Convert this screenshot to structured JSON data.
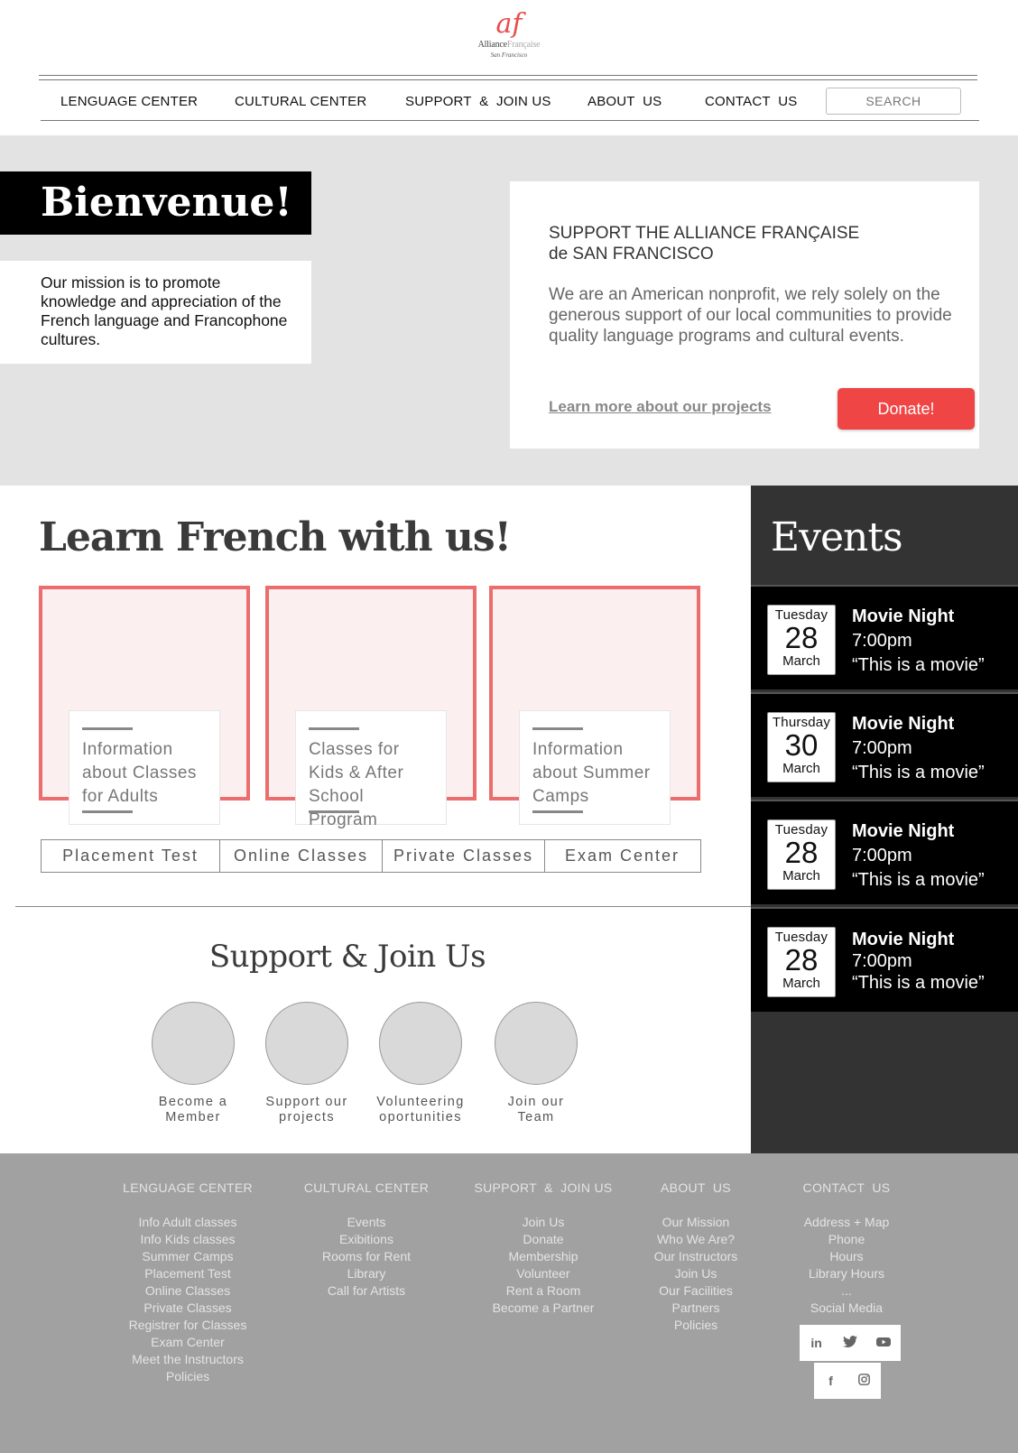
{
  "logo": {
    "mark": "af",
    "name_dark": "Alliance",
    "name_light": "Française",
    "city": "San Francisco"
  },
  "nav": {
    "items": [
      "LENGUAGE CENTER",
      "CULTURAL CENTER",
      "SUPPORT  &  JOIN US",
      "ABOUT  US",
      "CONTACT  US"
    ],
    "search_placeholder": "SEARCH"
  },
  "hero": {
    "welcome": "Bienvenue!",
    "mission": "Our mission is to promote knowledge and appreciation of the French language and Francophone cultures.",
    "support_title_1": "SUPPORT THE ALLIANCE FRANÇAISE",
    "support_title_2": "de SAN FRANCISCO",
    "support_body": "We are an American nonprofit, we rely solely on the generous support of our local communities to provide quality language programs and cultural events.",
    "learn_more": "Learn more about our projects",
    "donate": "Donate!"
  },
  "learn": {
    "title": "Learn French with us!",
    "cards": [
      "Information about Classes for Adults",
      "Classes for Kids & After School Program",
      "Information about Summer Camps"
    ],
    "tabs": [
      "Placement Test",
      "Online Classes",
      "Private Classes",
      "Exam Center"
    ]
  },
  "support_join": {
    "title": "Support & Join Us",
    "items": [
      {
        "line1": "Become a",
        "line2": "Member"
      },
      {
        "line1": "Support our",
        "line2": "projects"
      },
      {
        "line1": "Volunteering",
        "line2": "oportunities"
      },
      {
        "line1": "Join our",
        "line2": "Team"
      }
    ]
  },
  "events": {
    "title": "Events",
    "list": [
      {
        "dow": "Tuesday",
        "day": "28",
        "month": "March",
        "title": "Movie Night",
        "time": "7:00pm",
        "desc": "“This is a movie”"
      },
      {
        "dow": "Thursday",
        "day": "30",
        "month": "March",
        "title": "Movie Night",
        "time": "7:00pm",
        "desc": "“This is a movie”"
      },
      {
        "dow": "Tuesday",
        "day": "28",
        "month": "March",
        "title": "Movie Night",
        "time": "7:00pm",
        "desc": "“This is a movie”"
      },
      {
        "dow": "Tuesday",
        "day": "28",
        "month": "March",
        "title": "Movie Night",
        "time": "7:00pm",
        "desc": "“This is a movie”"
      }
    ]
  },
  "footer": {
    "columns": [
      {
        "head": "LENGUAGE CENTER",
        "links": [
          "Info Adult classes",
          "Info Kids classes",
          "Summer Camps",
          "Placement Test",
          "Online Classes",
          "Private Classes",
          "Registrer for Classes",
          "Exam Center",
          "Meet the Instructors",
          "Policies"
        ]
      },
      {
        "head": "CULTURAL CENTER",
        "links": [
          "Events",
          "Exibitions",
          "Rooms for Rent",
          "Library",
          "Call for Artists"
        ]
      },
      {
        "head": "SUPPORT  &  JOIN US",
        "links": [
          "Join Us",
          "Donate",
          "Membership",
          "Volunteer",
          "Rent a Room",
          "Become a Partner"
        ]
      },
      {
        "head": "ABOUT  US",
        "links": [
          "Our Mission",
          "Who We Are?",
          "Our Instructors",
          "Join Us",
          "Our Facilities",
          "Partners",
          "Policies"
        ]
      },
      {
        "head": "CONTACT  US",
        "links": [
          "Address + Map",
          "Phone",
          "Hours",
          "Library Hours",
          "...",
          "Social Media"
        ]
      }
    ],
    "social": {
      "linkedin": "in",
      "twitter": "🐦",
      "youtube": "▶",
      "facebook": "f",
      "instagram": "◙"
    }
  },
  "colors": {
    "accent": "#f04545",
    "card_border": "#ec6d6d",
    "hero_bg": "#e3e3e3",
    "events_bg": "#333333",
    "footer_bg": "#a1a1a1"
  }
}
